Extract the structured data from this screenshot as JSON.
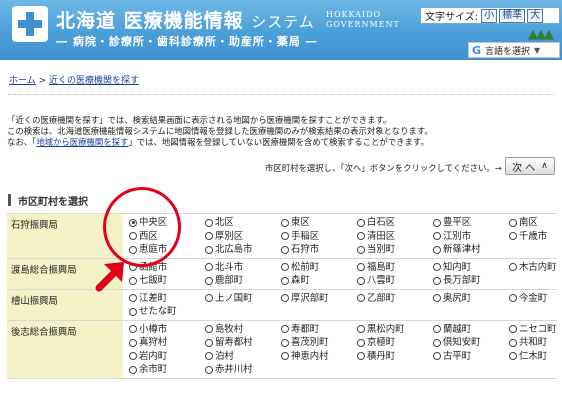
{
  "header": {
    "title": "北海道 医療機能情報",
    "title_suffix": "システム",
    "subtitle": "― 病院・診療所・歯科診療所・助産所・薬局 ―",
    "gov_line1": "HOKKAIDO",
    "gov_line2": "GOVERNMENT",
    "font_size_label": "文字サイズ:",
    "font_size_options": [
      "小",
      "標準",
      "大"
    ],
    "translate_label": "言語を選択",
    "translate_logo": "G",
    "brand_color": "#4a9ed8"
  },
  "breadcrumb": {
    "home": "ホーム",
    "separator": " > ",
    "current": "近くの医療機関を探す"
  },
  "info": {
    "line1": "「近くの医療機関を探す」では、検索結果画面に表示される地図から医療機関を探すことができます。",
    "line2": "この検索は、北海道医療機能情報システムに地図情報を登録した医療機関のみが検索結果の表示対象となります。",
    "line3_prefix": "なお、「",
    "line3_link": "地域から医療機関を探す",
    "line3_suffix": "」では、地図情報を登録していない医療機関を含めて検索することができます。"
  },
  "instruction": "市区町村を選択し、「次へ」ボタンをクリックしてください。",
  "next_button": "次 へ",
  "section_title": "市区町村を選択",
  "regions": [
    {
      "name": "石狩振興局",
      "municipalities": [
        "中央区",
        "北区",
        "東区",
        "白石区",
        "豊平区",
        "南区",
        "西区",
        "厚別区",
        "手稲区",
        "清田区",
        "江別市",
        "千歳市",
        "恵庭市",
        "北広島市",
        "石狩市",
        "当別町",
        "新篠津村"
      ]
    },
    {
      "name": "渡島総合振興局",
      "municipalities": [
        "函館市",
        "北斗市",
        "松前町",
        "福島町",
        "知内町",
        "木古内町",
        "七飯町",
        "鹿部町",
        "森町",
        "八雲町",
        "長万部町"
      ]
    },
    {
      "name": "檜山振興局",
      "municipalities": [
        "江差町",
        "上ノ国町",
        "厚沢部町",
        "乙部町",
        "奥尻町",
        "今金町",
        "せたな町"
      ]
    },
    {
      "name": "後志総合振興局",
      "municipalities": [
        "小樽市",
        "島牧村",
        "寿都町",
        "黒松内町",
        "蘭越町",
        "ニセコ町",
        "真狩村",
        "留寿都村",
        "喜茂別町",
        "京極町",
        "倶知安町",
        "共和町",
        "岩内町",
        "泊村",
        "神恵内村",
        "積丹町",
        "古平町",
        "仁木町",
        "余市町",
        "赤井川村"
      ]
    }
  ],
  "selected": "中央区",
  "annotation_color": "#e0001b"
}
